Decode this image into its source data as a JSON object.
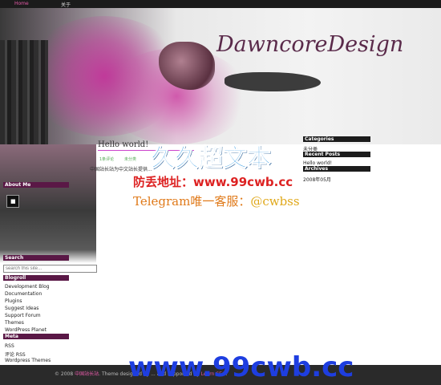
{
  "topnav": {
    "home": "Home",
    "about": "关于"
  },
  "header": {
    "logo": "DawncoreDesign"
  },
  "sidebar_left": {
    "about_title": "About Me",
    "search_title": "Search",
    "search_placeholder": "search this site...",
    "blogroll_title": "Blogroll",
    "blogroll": [
      "Development Blog",
      "Documentation",
      "Plugins",
      "Suggest Ideas",
      "Support Forum",
      "Themes",
      "WordPress Planet"
    ],
    "meta_title": "Meta",
    "meta": [
      "RSS",
      "评论 RSS",
      "Wordpress Themes"
    ]
  },
  "post": {
    "title": "Hello world!",
    "meta_left": "1条评论",
    "meta_right": "未分类",
    "body": "中国站长站为中文站长提供..."
  },
  "sidebar_right": {
    "categories_title": "Categories",
    "categories": [
      "未分类"
    ],
    "recent_title": "Recent Posts",
    "recent": [
      "Hello world!"
    ],
    "archives_title": "Archives",
    "archives": [
      "2008年05月"
    ]
  },
  "watermark": {
    "line1": "久久超文本",
    "line2": "防丢地址：www.99cwb.cc",
    "line3_label": "Telegram唯一客服：",
    "line3_handle": "@cwbss",
    "line4": "www.99cwb.cc"
  },
  "footer": {
    "prefix": "© 2008",
    "site": "中国站长站",
    "middle": ". Theme designed by ... and supported by",
    "sponsor": "Learn SEO",
    "suffix": "."
  }
}
